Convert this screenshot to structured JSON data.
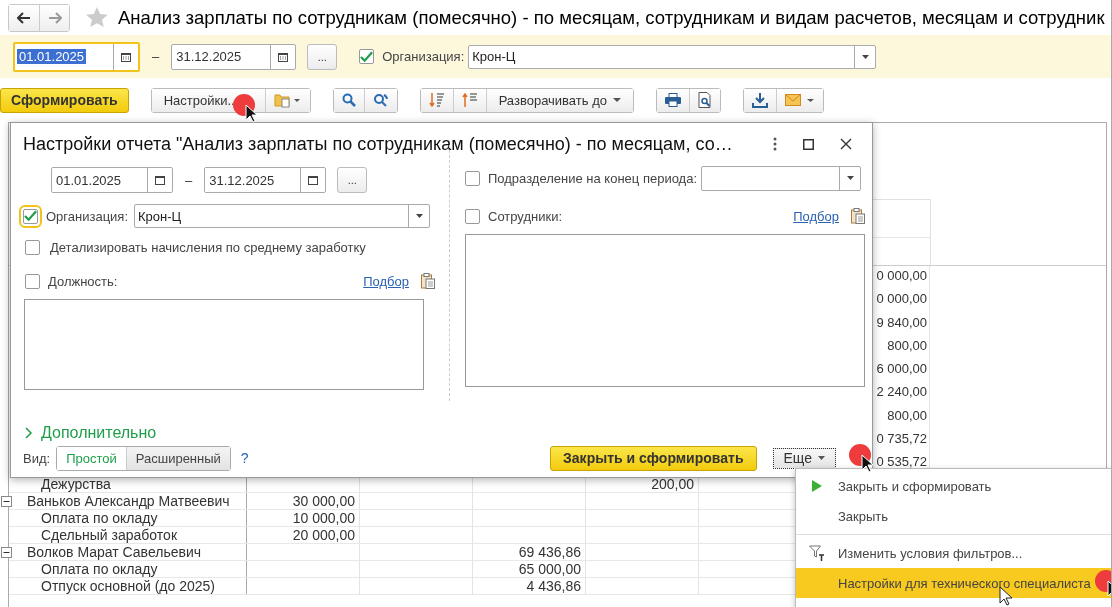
{
  "window": {
    "title": "Анализ зарплаты по сотрудникам (помесячно) - по месяцам, сотрудникам и видам расчетов, месяцам и сотрудник"
  },
  "filter_bar": {
    "date_from": {
      "value": "01.01.2025",
      "focused": true
    },
    "range_separator": "–",
    "date_to": {
      "value": "31.12.2025",
      "focused": false
    },
    "period_button": "...",
    "organization": {
      "checked": true,
      "label": "Организация:",
      "value": "Крон-Ц"
    }
  },
  "toolbar": {
    "generate_button": "Сформировать",
    "settings_button": "Настройки..",
    "expand_button": "Разворачивать до"
  },
  "report": {
    "partial_values": [
      "0 000,00",
      "0 000,00",
      "9 840,00",
      "800,00",
      "6 000,00",
      "2 240,00",
      "800,00",
      "0 735,72",
      "0 535,72"
    ],
    "rows": [
      {
        "kind": "item",
        "name": "Дежурства",
        "col_4": "200,00"
      },
      {
        "kind": "group",
        "name": "Ваньков Александр Матвеевич",
        "col_1": "30 000,00"
      },
      {
        "kind": "item",
        "name": "Оплата по окладу",
        "col_1": "10 000,00"
      },
      {
        "kind": "item",
        "name": "Сдельный заработок",
        "col_1": "20 000,00"
      },
      {
        "kind": "group",
        "name": "Волков Марат Савельевич",
        "col_3": "69 436,86"
      },
      {
        "kind": "item",
        "name": "Оплата по окладу",
        "col_3": "65 000,00"
      },
      {
        "kind": "item",
        "name": "Отпуск основной (до 2025)",
        "col_3": "4 436,86"
      }
    ]
  },
  "dialog": {
    "title": "Настройки отчета \"Анализ зарплаты по сотрудникам (помесячно) - по месяцам, со…",
    "date_from": "01.01.2025",
    "range_separator": "–",
    "date_to": "31.12.2025",
    "period_button": "...",
    "organization": {
      "checked": true,
      "label": "Организация:",
      "value": "Крон-Ц"
    },
    "detail_average": {
      "checked": false,
      "label": "Детализировать начисления по среднему заработку"
    },
    "position": {
      "checked": false,
      "label": "Должность:",
      "pick_link": "Подбор"
    },
    "department": {
      "checked": false,
      "label": "Подразделение на конец периода:"
    },
    "employees": {
      "checked": false,
      "label": "Сотрудники:",
      "pick_link": "Подбор"
    },
    "more_section": "Дополнительно",
    "view_label": "Вид:",
    "view_modes": [
      {
        "label": "Простой",
        "selected": true
      },
      {
        "label": "Расширенный",
        "selected": false
      }
    ],
    "help_link": "?",
    "close_generate_button": "Закрыть и сформировать",
    "more_button": "Еще"
  },
  "more_menu": [
    {
      "kind": "play",
      "label": "Закрыть и сформировать",
      "selected": false,
      "divider_before": false
    },
    {
      "kind": "plain",
      "label": "Закрыть",
      "selected": false,
      "divider_before": false
    },
    {
      "kind": "filter",
      "label": "Изменить условия фильтров...",
      "selected": false,
      "divider_before": true
    },
    {
      "kind": "plain",
      "label": "Настройки для технического специалиста",
      "selected": true,
      "divider_before": false
    }
  ]
}
